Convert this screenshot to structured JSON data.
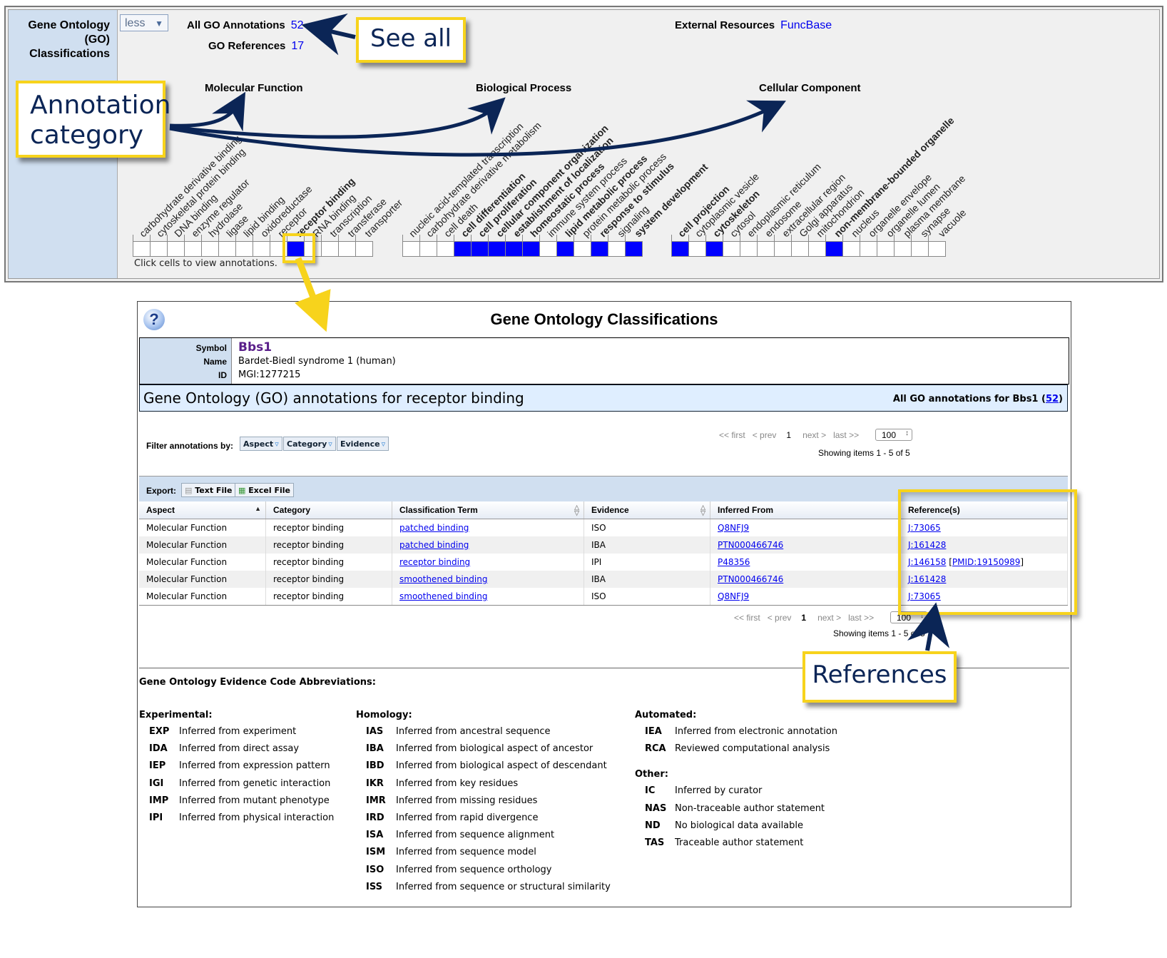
{
  "ribbon": {
    "label_lines": [
      "Gene Ontology",
      "(GO)",
      "Classifications"
    ],
    "toggle_select": "less",
    "all_go_annotations_label": "All GO Annotations",
    "all_go_annotations_count": "52",
    "go_references_label": "GO References",
    "go_references_count": "17",
    "external_resources_label": "External Resources",
    "external_resources_link": "FuncBase",
    "hint": "Click cells to view annotations.",
    "aspects": [
      {
        "title": "Molecular Function",
        "terms": [
          {
            "label": "carbohydrate derivative binding",
            "bold": false,
            "filled": false
          },
          {
            "label": "cytoskeletal protein binding",
            "bold": false,
            "filled": false
          },
          {
            "label": "DNA binding",
            "bold": false,
            "filled": false
          },
          {
            "label": "enzyme regulator",
            "bold": false,
            "filled": false
          },
          {
            "label": "hydrolase",
            "bold": false,
            "filled": false
          },
          {
            "label": "ligase",
            "bold": false,
            "filled": false
          },
          {
            "label": "lipid binding",
            "bold": false,
            "filled": false
          },
          {
            "label": "oxidoreductase",
            "bold": false,
            "filled": false
          },
          {
            "label": "receptor",
            "bold": false,
            "filled": false
          },
          {
            "label": "receptor binding",
            "bold": true,
            "filled": true
          },
          {
            "label": "RNA binding",
            "bold": false,
            "filled": false
          },
          {
            "label": "transcription",
            "bold": false,
            "filled": false
          },
          {
            "label": "transferase",
            "bold": false,
            "filled": false
          },
          {
            "label": "transporter",
            "bold": false,
            "filled": false
          }
        ]
      },
      {
        "title": "Biological Process",
        "terms": [
          {
            "label": "nucleic acid-templated transcription",
            "bold": false,
            "filled": false
          },
          {
            "label": "carbohydrate derivative metabolism",
            "bold": false,
            "filled": false
          },
          {
            "label": "cell death",
            "bold": false,
            "filled": false
          },
          {
            "label": "cell differentiation",
            "bold": true,
            "filled": true
          },
          {
            "label": "cell proliferation",
            "bold": true,
            "filled": true
          },
          {
            "label": "cellular component organization",
            "bold": true,
            "filled": true
          },
          {
            "label": "establishment of localization",
            "bold": true,
            "filled": true
          },
          {
            "label": "homeostatic process",
            "bold": true,
            "filled": true
          },
          {
            "label": "immune system process",
            "bold": false,
            "filled": false
          },
          {
            "label": "lipid metabolic process",
            "bold": true,
            "filled": true
          },
          {
            "label": "protein metabolic process",
            "bold": false,
            "filled": false
          },
          {
            "label": "response to stimulus",
            "bold": true,
            "filled": true
          },
          {
            "label": "signaling",
            "bold": false,
            "filled": false
          },
          {
            "label": "system development",
            "bold": true,
            "filled": true
          }
        ]
      },
      {
        "title": "Cellular Component",
        "terms": [
          {
            "label": "cell projection",
            "bold": true,
            "filled": true
          },
          {
            "label": "cytoplasmic vesicle",
            "bold": false,
            "filled": false
          },
          {
            "label": "cytoskeleton",
            "bold": true,
            "filled": true
          },
          {
            "label": "cytosol",
            "bold": false,
            "filled": false
          },
          {
            "label": "endoplasmic reticulum",
            "bold": false,
            "filled": false
          },
          {
            "label": "endosome",
            "bold": false,
            "filled": false
          },
          {
            "label": "extracellular region",
            "bold": false,
            "filled": false
          },
          {
            "label": "Golgi apparatus",
            "bold": false,
            "filled": false
          },
          {
            "label": "mitochondrion",
            "bold": false,
            "filled": false
          },
          {
            "label": "non-membrane-bounded organelle",
            "bold": true,
            "filled": true
          },
          {
            "label": "nucleus",
            "bold": false,
            "filled": false
          },
          {
            "label": "organelle envelope",
            "bold": false,
            "filled": false
          },
          {
            "label": "organelle lumen",
            "bold": false,
            "filled": false
          },
          {
            "label": "plasma membrane",
            "bold": false,
            "filled": false
          },
          {
            "label": "synapse",
            "bold": false,
            "filled": false
          },
          {
            "label": "vacuole",
            "bold": false,
            "filled": false
          }
        ]
      }
    ]
  },
  "callouts": {
    "see_all": "See all",
    "annotation_category_lines": [
      "Annotation",
      "category"
    ],
    "references": "References"
  },
  "colors": {
    "callout_border": "#f7d31c",
    "callout_text": "#0b2556",
    "filled_cell": "#0000ff",
    "link": "#0000ee",
    "symbol": "#5a1f8a"
  },
  "popup": {
    "title": "Gene Ontology Classifications",
    "help_icon_glyph": "?",
    "info": {
      "symbol_label": "Symbol",
      "symbol": "Bbs1",
      "name_label": "Name",
      "name": "Bardet-Biedl syndrome 1 (human)",
      "id_label": "ID",
      "id": "MGI:1277215"
    },
    "section_title": "Gene Ontology (GO) annotations for receptor binding",
    "all_go_prefix": "All GO annotations for Bbs1 (",
    "all_go_count": "52",
    "all_go_suffix": ")",
    "pager": {
      "first": "<< first",
      "prev": "< prev",
      "current": "1",
      "next": "next >",
      "last": "last >>",
      "page_size": "100",
      "showing": "Showing items 1 - 5 of 5",
      "showing_bottom": "Showing items 1 - 5 of 5"
    },
    "filter_label": "Filter annotations by:",
    "filters": [
      "Aspect",
      "Category",
      "Evidence"
    ],
    "export_label": "Export:",
    "exports": [
      "Text File",
      "Excel File"
    ],
    "table": {
      "columns": [
        "Aspect",
        "Category",
        "Classification Term",
        "Evidence",
        "Inferred From",
        "Reference(s)"
      ],
      "rows": [
        {
          "aspect": "Molecular Function",
          "category": "receptor binding",
          "term": "patched binding",
          "evidence": "ISO",
          "inferred": "Q8NFJ9",
          "ref": "J:73065",
          "pmid": ""
        },
        {
          "aspect": "Molecular Function",
          "category": "receptor binding",
          "term": "patched binding",
          "evidence": "IBA",
          "inferred": "PTN000466746",
          "ref": "J:161428",
          "pmid": ""
        },
        {
          "aspect": "Molecular Function",
          "category": "receptor binding",
          "term": "receptor binding",
          "evidence": "IPI",
          "inferred": "P48356",
          "ref": "J:146158",
          "pmid": "PMID:19150989"
        },
        {
          "aspect": "Molecular Function",
          "category": "receptor binding",
          "term": "smoothened binding",
          "evidence": "IBA",
          "inferred": "PTN000466746",
          "ref": "J:161428",
          "pmid": ""
        },
        {
          "aspect": "Molecular Function",
          "category": "receptor binding",
          "term": "smoothened binding",
          "evidence": "ISO",
          "inferred": "Q8NFJ9",
          "ref": "J:73065",
          "pmid": ""
        }
      ]
    },
    "evidence": {
      "title": "Gene Ontology Evidence Code Abbreviations:",
      "groups": [
        {
          "name": "Experimental:",
          "items": [
            {
              "code": "EXP",
              "desc": "Inferred from experiment"
            },
            {
              "code": "IDA",
              "desc": "Inferred from direct assay"
            },
            {
              "code": "IEP",
              "desc": "Inferred from expression pattern"
            },
            {
              "code": "IGI",
              "desc": "Inferred from genetic interaction"
            },
            {
              "code": "IMP",
              "desc": "Inferred from mutant phenotype"
            },
            {
              "code": "IPI",
              "desc": "Inferred from physical interaction"
            }
          ]
        },
        {
          "name": "Homology:",
          "items": [
            {
              "code": "IAS",
              "desc": "Inferred from ancestral sequence"
            },
            {
              "code": "IBA",
              "desc": "Inferred from biological aspect of ancestor"
            },
            {
              "code": "IBD",
              "desc": "Inferred from biological aspect of descendant"
            },
            {
              "code": "IKR",
              "desc": "Inferred from key residues"
            },
            {
              "code": "IMR",
              "desc": "Inferred from missing residues"
            },
            {
              "code": "IRD",
              "desc": "Inferred from rapid divergence"
            },
            {
              "code": "ISA",
              "desc": "Inferred from sequence alignment"
            },
            {
              "code": "ISM",
              "desc": "Inferred from sequence model"
            },
            {
              "code": "ISO",
              "desc": "Inferred from sequence orthology"
            },
            {
              "code": "ISS",
              "desc": "Inferred from sequence or structural similarity"
            }
          ]
        },
        {
          "name": "Automated:",
          "items": [
            {
              "code": "IEA",
              "desc": "Inferred from electronic annotation"
            },
            {
              "code": "RCA",
              "desc": "Reviewed computational analysis"
            }
          ]
        },
        {
          "name": "Other:",
          "items": [
            {
              "code": "IC",
              "desc": "Inferred by curator"
            },
            {
              "code": "NAS",
              "desc": "Non-traceable author statement"
            },
            {
              "code": "ND",
              "desc": "No biological data available"
            },
            {
              "code": "TAS",
              "desc": "Traceable author statement"
            }
          ]
        }
      ]
    }
  }
}
